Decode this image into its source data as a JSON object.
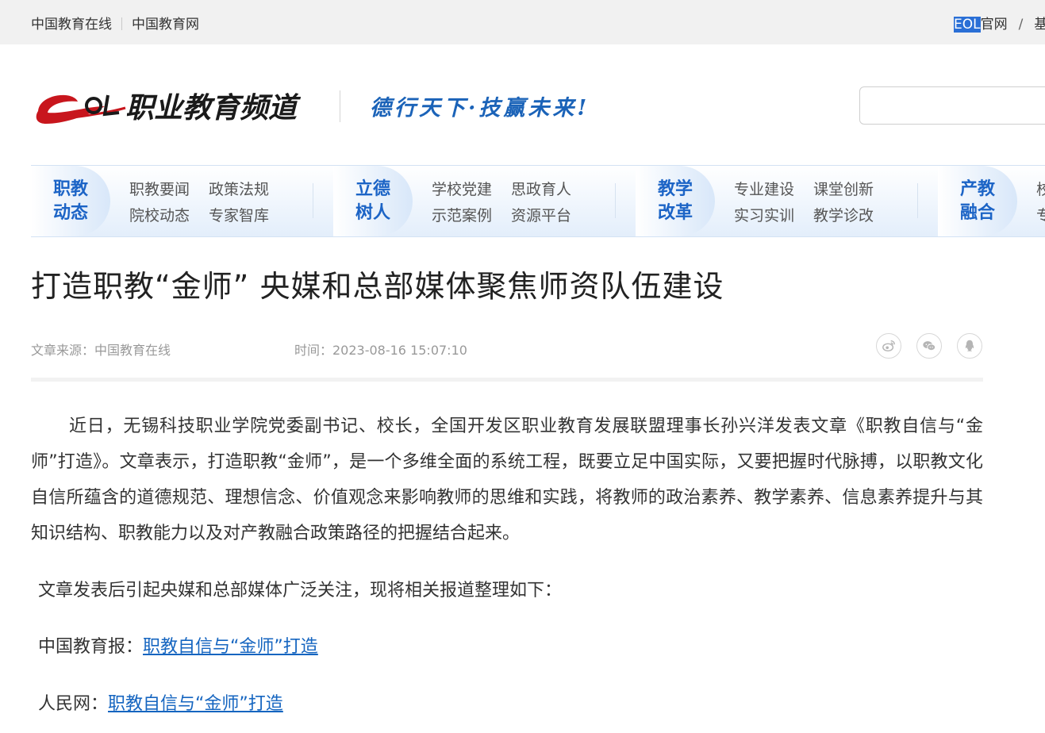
{
  "topbar": {
    "links": [
      "中国教育在线",
      "中国教育网"
    ],
    "right_highlight": "EOL",
    "right_text": "官网",
    "right_slash": "/",
    "right_cut": "基"
  },
  "header": {
    "logo_text": "职业教育频道",
    "slogan": "德行天下·技赢未来!",
    "search_placeholder": ""
  },
  "nav": [
    {
      "cat": [
        "职教",
        "动态"
      ],
      "links": [
        "职教要闻",
        "政策法规",
        "院校动态",
        "专家智库"
      ]
    },
    {
      "cat": [
        "立德",
        "树人"
      ],
      "links": [
        "学校党建",
        "思政育人",
        "示范案例",
        "资源平台"
      ]
    },
    {
      "cat": [
        "教学",
        "改革"
      ],
      "links": [
        "专业建设",
        "课堂创新",
        "实习实训",
        "教学诊改"
      ]
    },
    {
      "cat": [
        "产教",
        "融合"
      ],
      "links": [
        "校",
        "专"
      ]
    }
  ],
  "article": {
    "title": "打造职教“金师” 央媒和总部媒体聚焦师资队伍建设",
    "source": "文章来源：中国教育在线",
    "time": "时间：2023-08-16 15:07:10",
    "share_icons": [
      "weibo-icon",
      "wechat-icon",
      "qq-icon"
    ],
    "paragraph1": "近日，无锡科技职业学院党委副书记、校长，全国开发区职业教育发展联盟理事长孙兴洋发表文章《职教自信与“金师”打造》。文章表示，打造职教“金师”，是一个多维全面的系统工程，既要立足中国实际，又要把握时代脉搏，以职教文化自信所蕴含的道德规范、理想信念、价值观念来影响教师的思维和实践，将教师的政治素养、教学素养、信息素养提升与其知识结构、职教能力以及对产教融合政策路径的把握结合起来。",
    "paragraph2": "文章发表后引起央媒和总部媒体广泛关注，现将相关报道整理如下：",
    "reports": [
      {
        "source": "中国教育报：",
        "link": "职教自信与“金师”打造"
      },
      {
        "source": "人民网：",
        "link": "职教自信与“金师”打造"
      }
    ]
  }
}
